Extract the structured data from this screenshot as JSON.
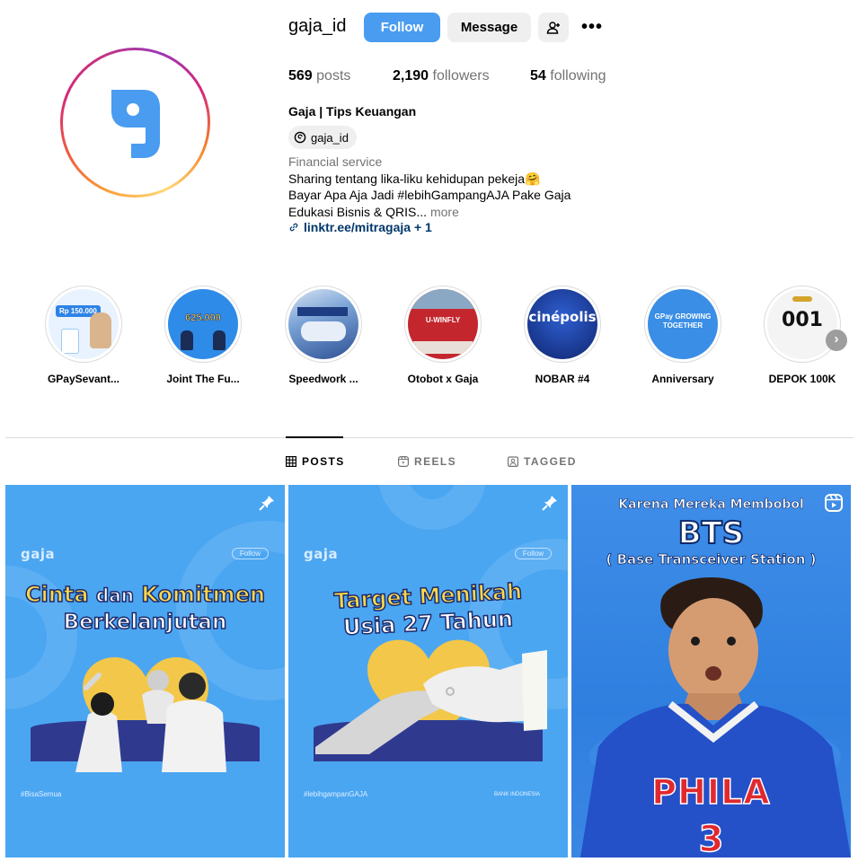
{
  "profile": {
    "username": "gaja_id",
    "follow_label": "Follow",
    "message_label": "Message",
    "posts_count": "569",
    "posts_label": "posts",
    "followers_count": "2,190",
    "followers_label": "followers",
    "following_count": "54",
    "following_label": "following",
    "full_name": "Gaja | Tips Keuangan",
    "threads_handle": "gaja_id",
    "category": "Financial service",
    "bio_line1": "Sharing tentang lika-liku kehidupan pekeja🤗",
    "bio_line2": "Bayar Apa Aja Jadi #lebihGampangAJA Pake Gaja",
    "bio_line3": "Edukasi Bisnis & QRIS...",
    "more_label": "more",
    "link": "linktr.ee/mitragaja + 1",
    "avatar_icon": "gaja-logo-icon",
    "brand_color": "#4a9cf0"
  },
  "highlights": [
    {
      "label": "GPaySevant...",
      "art": "Rp 150.000",
      "bg": "#e9f3ff"
    },
    {
      "label": "Joint The Fu...",
      "art": "625.000",
      "bg": "#2e8be8"
    },
    {
      "label": "Speedwork ...",
      "art": "",
      "bg": "#2f5ea8"
    },
    {
      "label": "Otobot x Gaja",
      "art": "U-WINFLY",
      "bg": "#c4262e"
    },
    {
      "label": "NOBAR #4",
      "art": "cinépolis",
      "bg": "#1b3c9b"
    },
    {
      "label": "Anniversary",
      "art": "GPay GROWING TOGETHER",
      "bg": "#3a8ee6"
    },
    {
      "label": "DEPOK 100K",
      "art": "001",
      "bg": "#f4f4f4"
    }
  ],
  "tabs": {
    "posts": "POSTS",
    "reels": "REELS",
    "tagged": "TAGGED"
  },
  "posts": [
    {
      "brand": "gaja",
      "follow": "Follow",
      "headline_a": "Cinta",
      "headline_b": "dan",
      "headline_c": "Komitmen",
      "headline_d": "Berkelanjutan",
      "hashtag": "#BisaSemua"
    },
    {
      "brand": "gaja",
      "follow": "Follow",
      "headline_a": "Target Menikah",
      "headline_b": "Usia 27 Tahun",
      "hashtag": "#lebihgampanGAJA",
      "footer_logo": "BANK INDONESIA"
    },
    {
      "top": "Karena Mereka Membobol",
      "big": "BTS",
      "sub": "( Base Transceiver Station )",
      "jersey": "PHILA",
      "number": "3"
    }
  ]
}
